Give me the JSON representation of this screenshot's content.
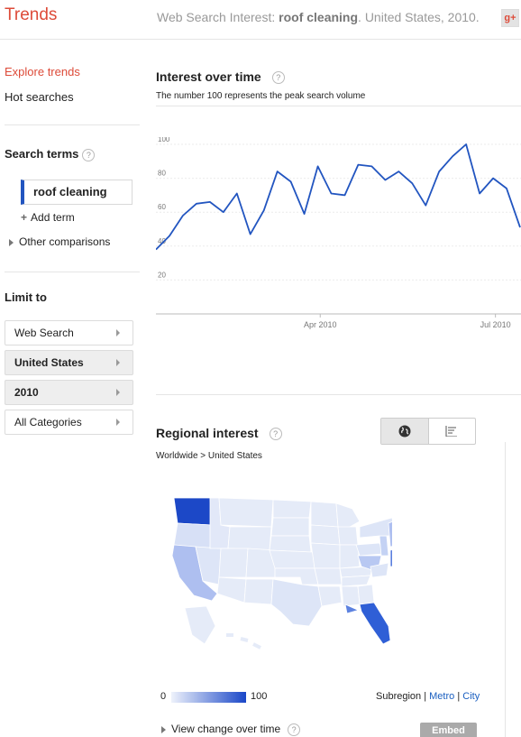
{
  "header": {
    "logo": "Trends",
    "title_prefix": "Web Search Interest: ",
    "term": "roof cleaning",
    "title_suffix": ". United States, 2010.",
    "gplus": "g+"
  },
  "sidebar": {
    "explore": "Explore trends",
    "hot": "Hot searches",
    "search_terms_heading": "Search terms",
    "term": "roof cleaning",
    "add_term": "Add term",
    "other_comparisons": "Other comparisons",
    "limit_heading": "Limit to",
    "limits": [
      "Web Search",
      "United States",
      "2010",
      "All Categories"
    ]
  },
  "interest": {
    "title": "Interest over time",
    "subtitle": "The number 100 represents the peak search volume",
    "x_ticks": [
      "Apr 2010",
      "Jul 2010"
    ]
  },
  "regional": {
    "title": "Regional interest",
    "breadcrumb": "Worldwide > United States",
    "legend_min": "0",
    "legend_max": "100",
    "subregion_label": "Subregion",
    "metro": "Metro",
    "city": "City",
    "separator": "|",
    "view_change": "View change over time",
    "embed": "Embed",
    "low_color": "#eef2fb",
    "high_color": "#1a47c8"
  },
  "chart_data": {
    "type": "line",
    "title": "Interest over time",
    "ylim": [
      0,
      100
    ],
    "y_ticks": [
      20,
      40,
      60,
      80,
      100
    ],
    "x_ticks": [
      "Apr 2010",
      "Jul 2010"
    ],
    "grid": true,
    "series": [
      {
        "color": "#2255c0",
        "values": [
          38,
          46,
          58,
          65,
          66,
          60,
          71,
          47,
          61,
          84,
          78,
          59,
          87,
          71,
          70,
          88,
          87,
          79,
          84,
          77,
          64,
          84,
          93,
          100,
          71,
          80,
          74,
          51
        ]
      }
    ]
  }
}
